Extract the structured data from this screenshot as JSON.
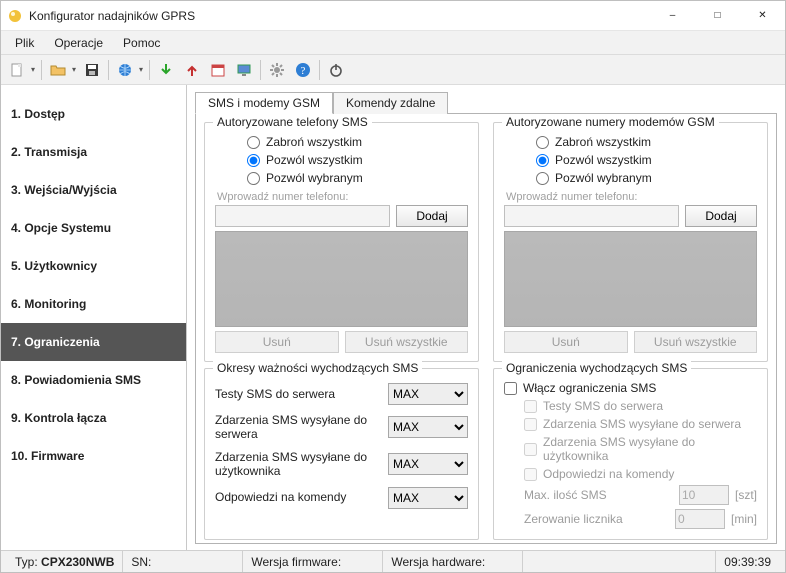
{
  "window": {
    "title": "Konfigurator nadajników GPRS"
  },
  "menu": {
    "file": "Plik",
    "operations": "Operacje",
    "help": "Pomoc"
  },
  "sidebar": {
    "items": [
      {
        "label": "1. Dostęp"
      },
      {
        "label": "2. Transmisja"
      },
      {
        "label": "3. Wejścia/Wyjścia"
      },
      {
        "label": "4. Opcje Systemu"
      },
      {
        "label": "5. Użytkownicy"
      },
      {
        "label": "6. Monitoring"
      },
      {
        "label": "7. Ograniczenia"
      },
      {
        "label": "8. Powiadomienia SMS"
      },
      {
        "label": "9. Kontrola łącza"
      },
      {
        "label": "10. Firmware"
      }
    ],
    "selectedIndex": 6
  },
  "tabs": {
    "sms": "SMS i modemy GSM",
    "remote": "Komendy zdalne"
  },
  "group": {
    "phones": {
      "legend": "Autoryzowane telefony SMS",
      "opt_forbid": "Zabroń wszystkim",
      "opt_allow_all": "Pozwól wszystkim",
      "opt_allow_some": "Pozwól wybranym",
      "input_label": "Wprowadź numer telefonu:",
      "add": "Dodaj",
      "remove": "Usuń",
      "remove_all": "Usuń wszystkie"
    },
    "modems": {
      "legend": "Autoryzowane numery modemów GSM",
      "opt_forbid": "Zabroń wszystkim",
      "opt_allow_all": "Pozwól wszystkim",
      "opt_allow_some": "Pozwól wybranym",
      "input_label": "Wprowadź numer telefonu:",
      "add": "Dodaj",
      "remove": "Usuń",
      "remove_all": "Usuń wszystkie"
    },
    "periods": {
      "legend": "Okresy ważności wychodzących SMS",
      "row1": "Testy SMS do serwera",
      "row2": "Zdarzenia SMS wysyłane do serwera",
      "row3": "Zdarzenia SMS wysyłane do użytkownika",
      "row4": "Odpowiedzi na komendy",
      "value": "MAX"
    },
    "limits": {
      "legend": "Ograniczenia wychodzących SMS",
      "enable": "Włącz ograniczenia SMS",
      "c1": "Testy SMS do serwera",
      "c2": "Zdarzenia SMS wysyłane do serwera",
      "c3": "Zdarzenia SMS wysyłane do użytkownika",
      "c4": "Odpowiedzi na komendy",
      "max_label": "Max. ilość SMS",
      "max_value": "10",
      "max_unit": "[szt]",
      "reset_label": "Zerowanie licznika",
      "reset_value": "0",
      "reset_unit": "[min]"
    }
  },
  "status": {
    "type_label": "Typ:",
    "type_value": "CPX230NWB",
    "sn_label": "SN:",
    "fw_label": "Wersja firmware:",
    "hw_label": "Wersja hardware:",
    "clock": "09:39:39"
  }
}
